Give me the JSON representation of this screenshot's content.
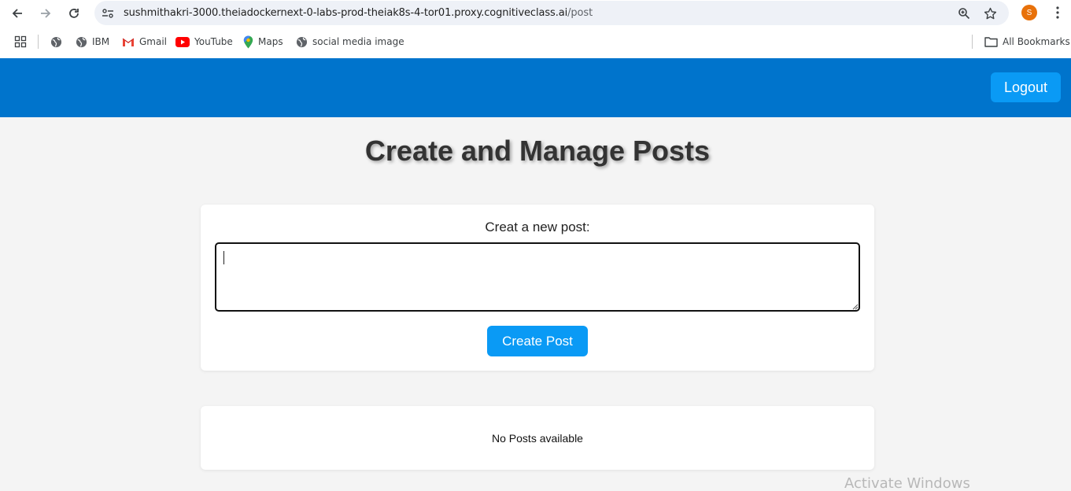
{
  "browser": {
    "url_host": "sushmithakri-3000.theiadockernext-0-labs-prod-theiak8s-4-tor01.proxy.cognitiveclass.ai",
    "url_path": "/post",
    "profile_initial": "S",
    "bookmarks": [
      {
        "label": "IBM",
        "icon": "globe-icon"
      },
      {
        "label": "Gmail",
        "icon": "gmail-icon"
      },
      {
        "label": "YouTube",
        "icon": "youtube-icon"
      },
      {
        "label": "Maps",
        "icon": "maps-icon"
      },
      {
        "label": "social media image",
        "icon": "globe-icon"
      }
    ],
    "all_bookmarks_label": "All Bookmarks"
  },
  "app": {
    "logout_label": "Logout",
    "title": "Create and Manage Posts",
    "create_label": "Creat a new post:",
    "post_value": "",
    "create_button_label": "Create Post",
    "empty_message": "No Posts available"
  },
  "system": {
    "watermark": "Activate Windows"
  },
  "colors": {
    "header": "#0074cc",
    "button": "#0a9af5",
    "page_bg": "#f4f4f4"
  }
}
